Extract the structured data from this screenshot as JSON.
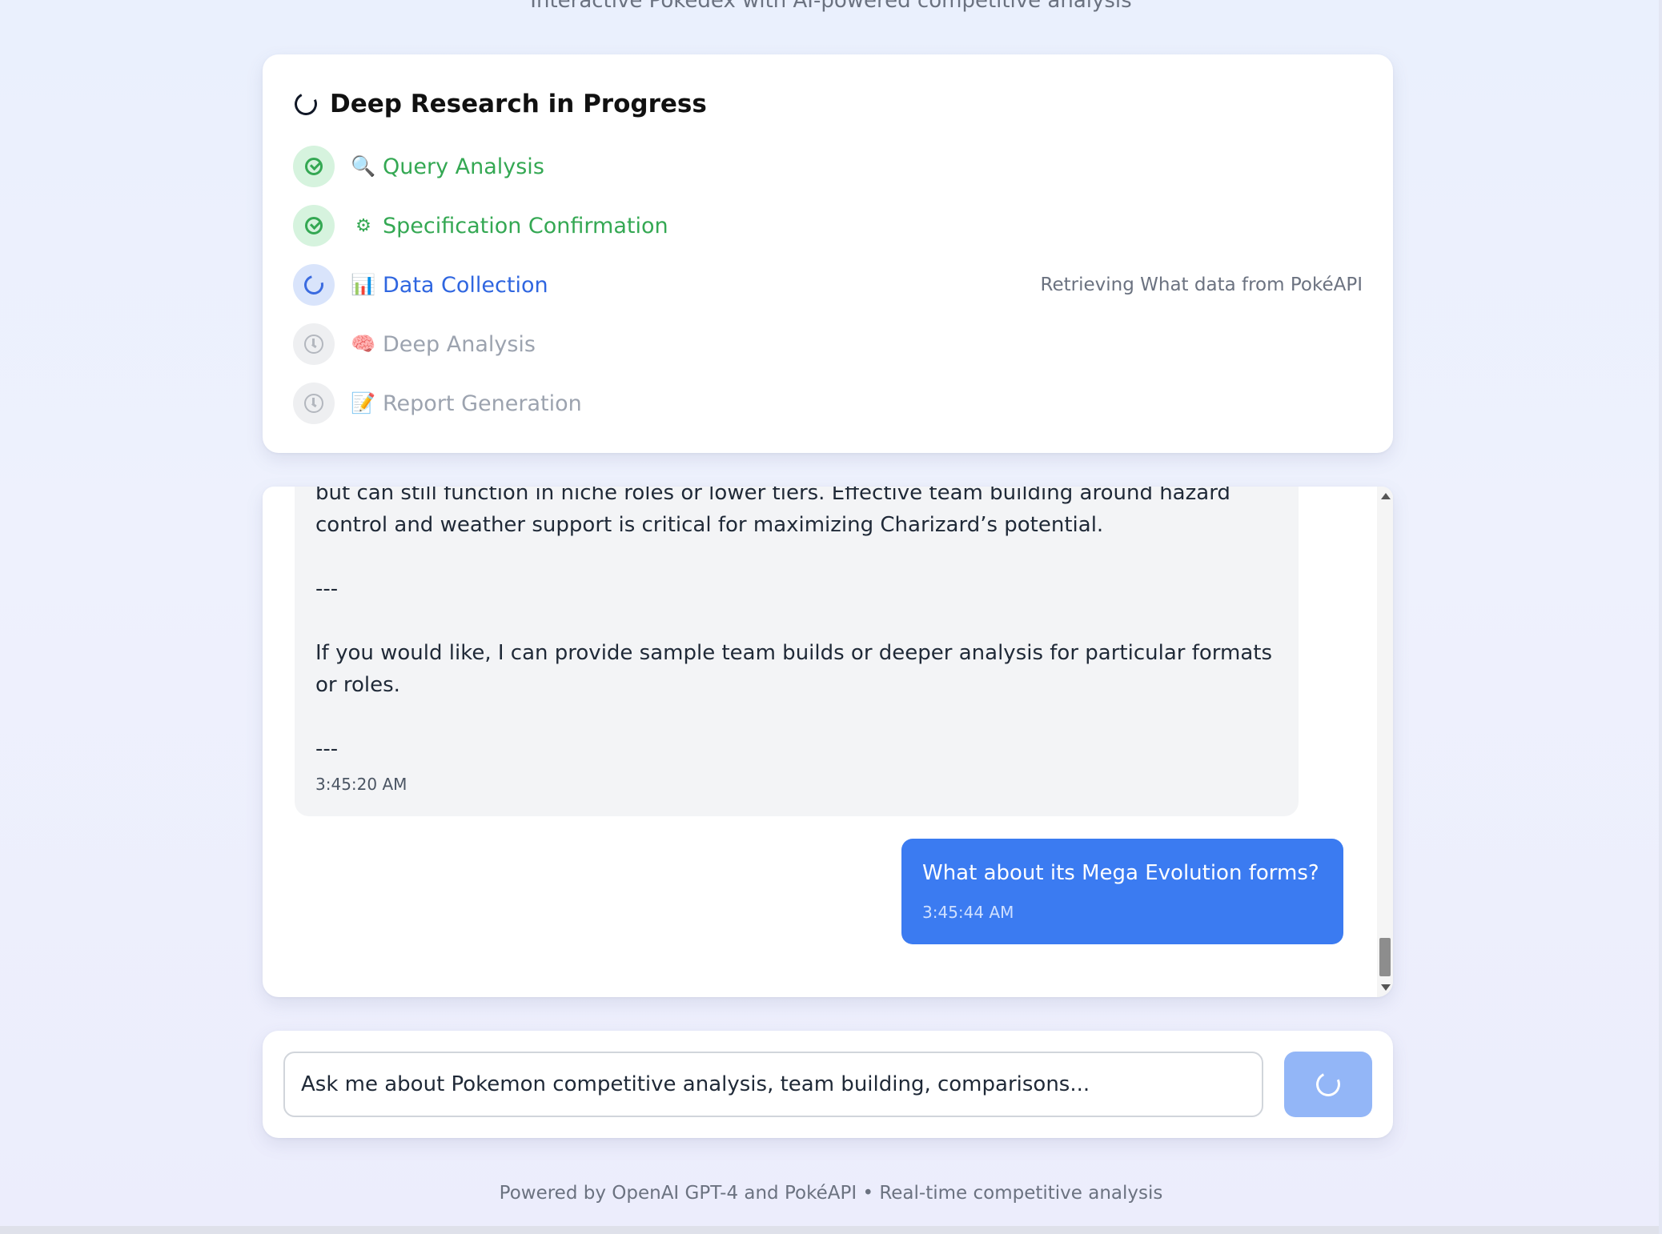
{
  "header": {
    "subtitle": "Interactive Pokedex with AI-powered competitive analysis"
  },
  "research": {
    "title": "Deep Research in Progress",
    "steps": [
      {
        "emoji": "🔍",
        "label": "Query Analysis",
        "state": "done",
        "status": ""
      },
      {
        "emoji": "⚙",
        "label": "Specification Confirmation",
        "state": "done",
        "status": ""
      },
      {
        "emoji": "📊",
        "label": "Data Collection",
        "state": "active",
        "status": "Retrieving What data from PokéAPI"
      },
      {
        "emoji": "🧠",
        "label": "Deep Analysis",
        "state": "pending",
        "status": ""
      },
      {
        "emoji": "📝",
        "label": "Report Generation",
        "state": "pending",
        "status": ""
      }
    ]
  },
  "chat": {
    "ai_message": {
      "paragraphs": [
        "but can still function in niche roles or lower tiers. Effective team building around hazard control and weather support is critical for maximizing Charizard’s potential.",
        "---",
        "If you would like, I can provide sample team builds or deeper analysis for particular formats or roles.",
        "---"
      ],
      "time": "3:45:20 AM"
    },
    "user_message": {
      "text": "What about its Mega Evolution forms?",
      "time": "3:45:44 AM"
    }
  },
  "input": {
    "placeholder": "Ask me about Pokemon competitive analysis, team building, comparisons...",
    "value": ""
  },
  "footer": {
    "text": "Powered by OpenAI GPT-4 and PokéAPI • Real-time competitive analysis"
  },
  "colors": {
    "done": "#34a853",
    "active": "#2f66e0",
    "pending": "#9ca3af",
    "user_bubble": "#3b7bf1",
    "send_button": "#93b6f7"
  },
  "scroll": {
    "position_fraction": 0.97
  }
}
